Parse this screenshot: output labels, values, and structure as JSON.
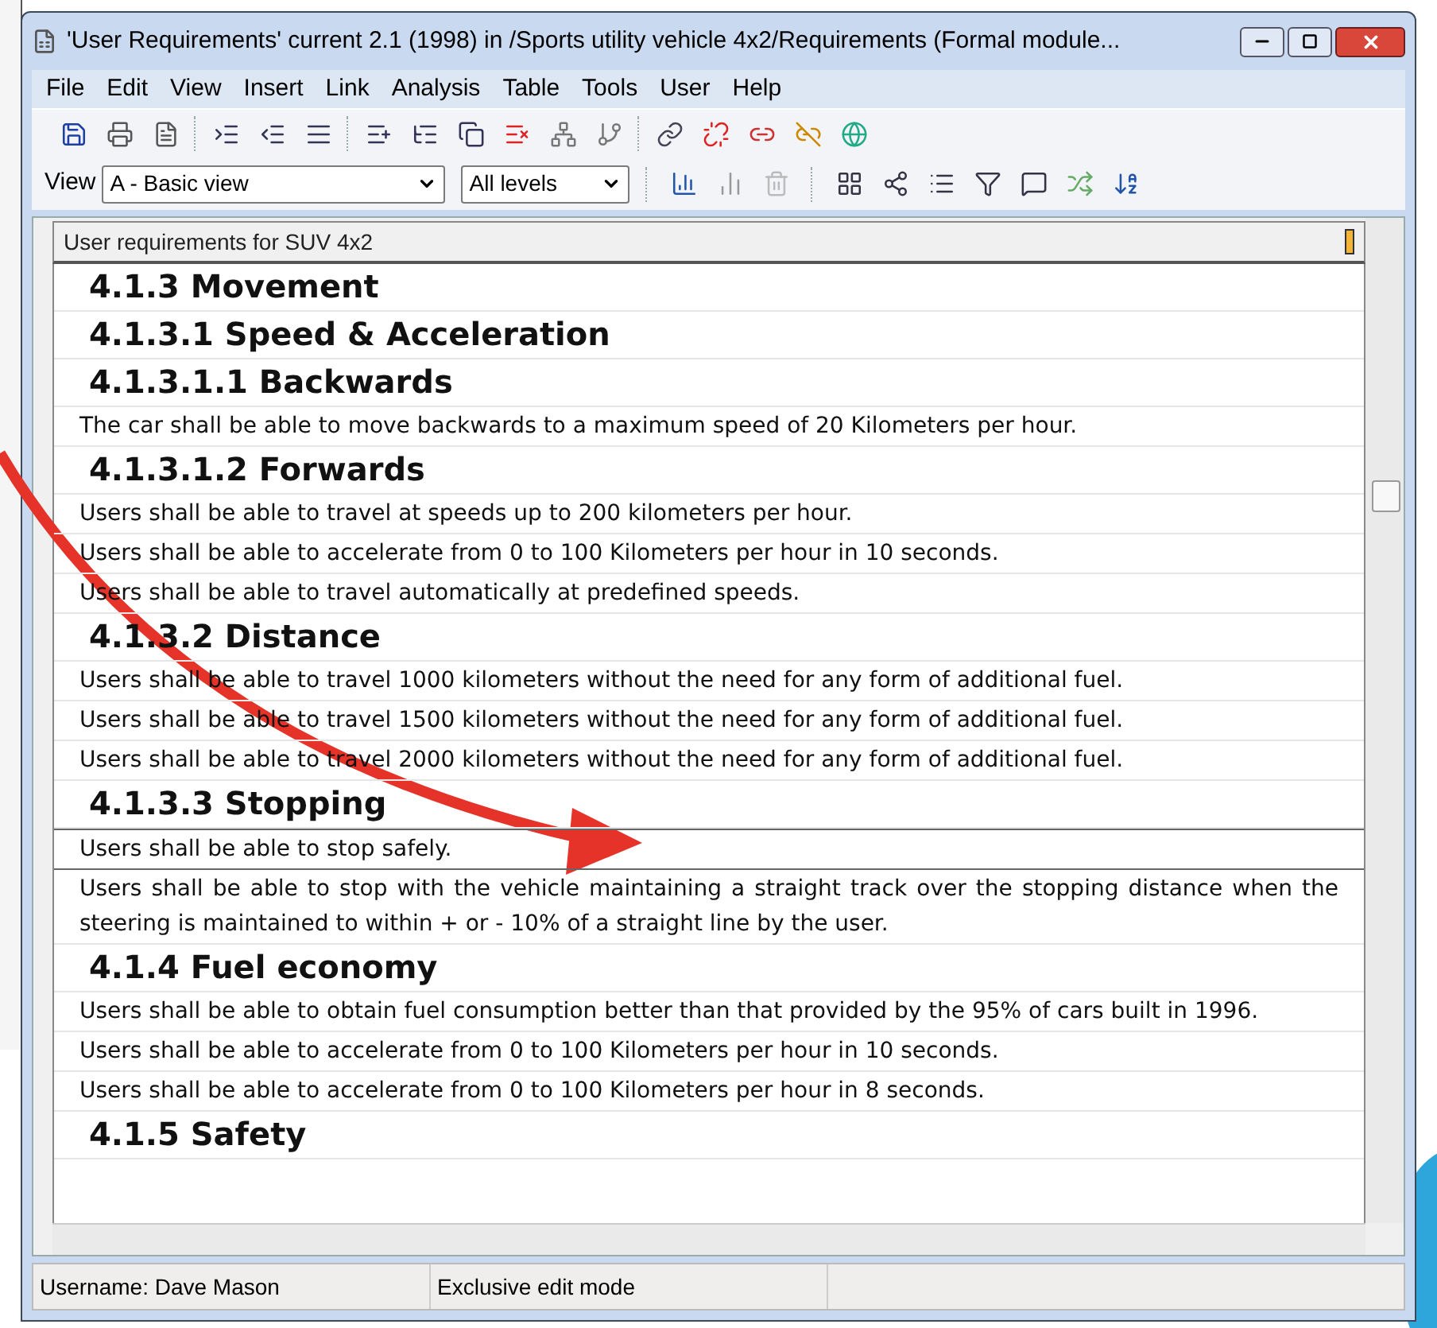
{
  "window": {
    "title": "'User Requirements' current 2.1 (1998) in /Sports utility vehicle 4x2/Requirements (Formal module..."
  },
  "menu": [
    {
      "label": "File"
    },
    {
      "label": "Edit"
    },
    {
      "label": "View"
    },
    {
      "label": "Insert"
    },
    {
      "label": "Link"
    },
    {
      "label": "Analysis"
    },
    {
      "label": "Table"
    },
    {
      "label": "Tools"
    },
    {
      "label": "User"
    },
    {
      "label": "Help"
    }
  ],
  "toolbar": {
    "view_label": "View",
    "view_select": "A - Basic view",
    "level_select": "All levels"
  },
  "module": {
    "header": "User requirements for SUV 4x2",
    "rows": [
      {
        "kind": "heading",
        "text": "4.1.3 Movement",
        "selected": false
      },
      {
        "kind": "heading",
        "text": "4.1.3.1 Speed & Acceleration",
        "selected": false
      },
      {
        "kind": "heading",
        "text": "4.1.3.1.1 Backwards",
        "selected": false
      },
      {
        "kind": "text",
        "text": "The car shall be able to move backwards to a maximum speed of 20 Kilometers per hour.",
        "selected": false
      },
      {
        "kind": "heading",
        "text": "4.1.3.1.2 Forwards",
        "selected": false
      },
      {
        "kind": "text",
        "text": "Users shall be able to travel at speeds up to 200 kilometers per hour.",
        "selected": false
      },
      {
        "kind": "text",
        "text": "Users shall be able to accelerate from 0 to 100 Kilometers per hour in 10 seconds.",
        "selected": false
      },
      {
        "kind": "text",
        "text": "Users shall be able to travel automatically at predefined speeds.",
        "selected": false
      },
      {
        "kind": "heading",
        "text": "4.1.3.2 Distance",
        "selected": false
      },
      {
        "kind": "text",
        "text": "Users shall be able to travel 1000 kilometers without the need for any form of additional fuel.",
        "selected": false
      },
      {
        "kind": "text",
        "text": "Users shall be able to travel 1500 kilometers without the need for any form of additional fuel.",
        "selected": false
      },
      {
        "kind": "text",
        "text": "Users shall be able to travel 2000 kilometers without the need for any form of additional fuel.",
        "selected": false
      },
      {
        "kind": "heading",
        "text": "4.1.3.3 Stopping",
        "selected": false
      },
      {
        "kind": "text",
        "text": "Users shall be able to stop safely.",
        "selected": true
      },
      {
        "kind": "text",
        "text": "Users shall be able to stop with the vehicle maintaining a straight track over the stopping distance when the steering is maintained to within + or - 10% of a straight line by the user.",
        "selected": false
      },
      {
        "kind": "heading",
        "text": "4.1.4 Fuel economy",
        "selected": false
      },
      {
        "kind": "text",
        "text": "Users shall be able to obtain fuel consumption better than that provided by the 95% of cars built in 1996.",
        "selected": false
      },
      {
        "kind": "text",
        "text": "Users shall be able to accelerate from 0 to 100 Kilometers per hour in 10 seconds.",
        "selected": false
      },
      {
        "kind": "text",
        "text": "Users shall be able to accelerate from 0 to 100 Kilometers per hour in 8 seconds.",
        "selected": false
      },
      {
        "kind": "heading",
        "text": "4.1.5 Safety",
        "selected": false
      }
    ]
  },
  "status_bar": [
    {
      "text": "Username: Dave Mason"
    },
    {
      "text": "Exclusive edit mode"
    }
  ]
}
